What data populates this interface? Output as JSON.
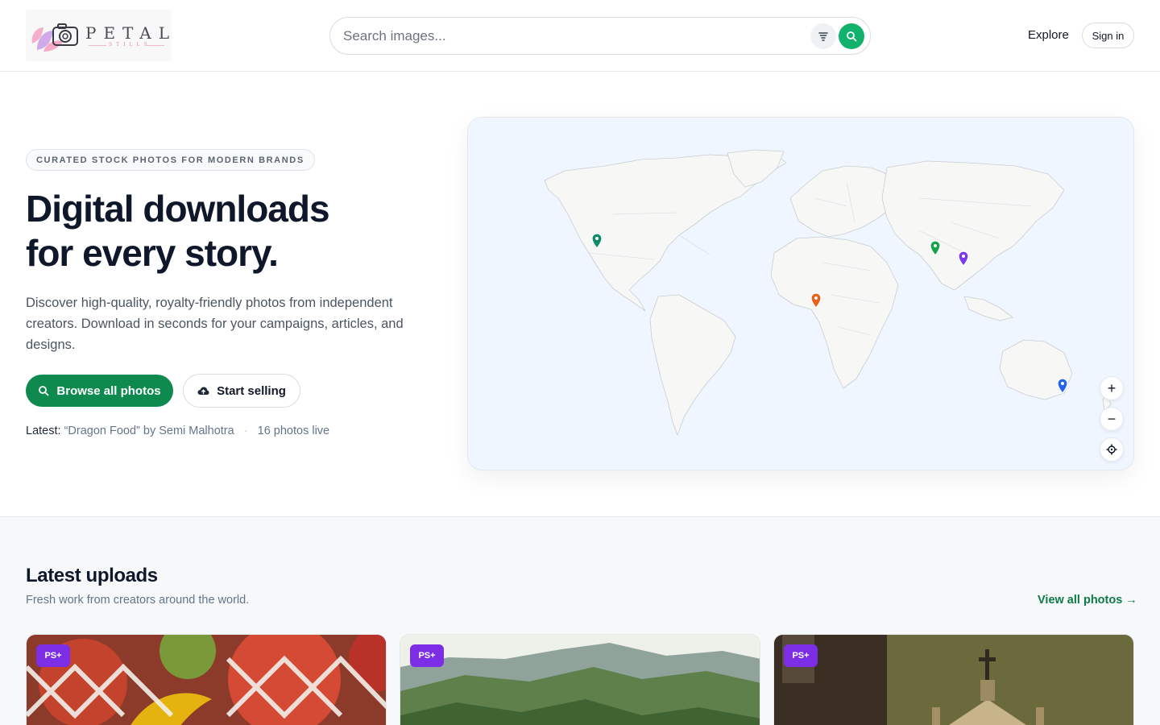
{
  "brand": {
    "name": "PETAL",
    "tagline": "STILLS"
  },
  "search": {
    "placeholder": "Search images..."
  },
  "nav": {
    "explore": "Explore",
    "sign_in": "Sign in"
  },
  "hero": {
    "badge": "CURATED STOCK PHOTOS FOR MODERN BRANDS",
    "title_line1": "Digital downloads",
    "title_line2": "for every story.",
    "lead": "Discover high-quality, royalty-friendly photos from independent creators. Download in seconds for your campaigns, articles, and designs.",
    "primary_cta": "Browse all photos",
    "secondary_cta": "Start selling",
    "latest_label": "Latest:",
    "latest_value": "“Dragon Food” by Semi Malhotra",
    "photos_live": "16 photos live"
  },
  "map": {
    "pins": [
      {
        "color": "#0f8a6b",
        "region": "North America (west coast)"
      },
      {
        "color": "#e8621a",
        "region": "West Africa"
      },
      {
        "color": "#16a34a",
        "region": "South Asia"
      },
      {
        "color": "#7c3aed",
        "region": "Southeast Asia"
      },
      {
        "color": "#2563eb",
        "region": "Australia"
      }
    ],
    "controls": {
      "zoom_in": "+",
      "zoom_out": "−"
    }
  },
  "uploads": {
    "title": "Latest uploads",
    "subtitle": "Fresh work from creators around the world.",
    "view_all": "View all photos →",
    "cards": [
      {
        "badge": "PS+",
        "subject": "dragon fruit"
      },
      {
        "badge": "PS+",
        "subject": "mountains"
      },
      {
        "badge": "PS+",
        "subject": "church facade"
      }
    ]
  },
  "colors": {
    "accent_green": "#0e8a4f",
    "search_button": "#10b26c",
    "ps_badge": "#7c2ee6",
    "map_water": "#eff6ff"
  }
}
